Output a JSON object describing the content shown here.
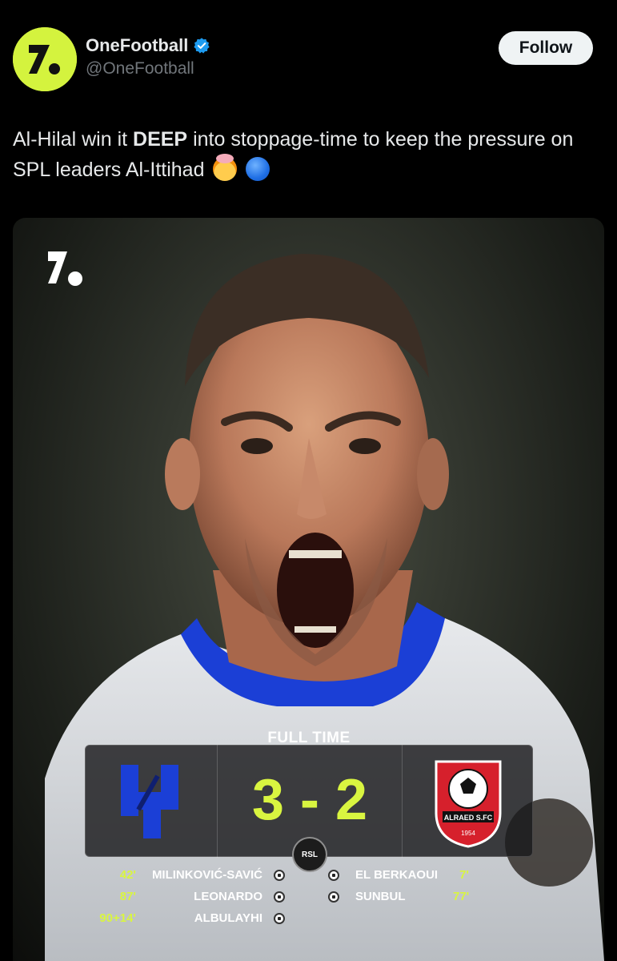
{
  "post": {
    "display_name": "OneFootball",
    "handle": "@OneFootball",
    "follow_label": "Follow",
    "text_before": "Al-Hilal win it ",
    "text_bold": "DEEP",
    "text_after": " into stoppage-time to keep the pressure on SPL leaders Al-Ittihad",
    "emoji_1": "exploding-head-emoji",
    "emoji_2": "blue-circle-emoji"
  },
  "graphic": {
    "status_label": "FULL TIME",
    "home_score": "3",
    "separator": "-",
    "away_score": "2",
    "home_team_icon": "al-hilal-crest",
    "away_team_icon": "al-raed-crest",
    "league_logo_text": "RSL",
    "away_crest_text": "ALRAED S.FC",
    "away_crest_year": "1954",
    "home_scorers": [
      {
        "minute": "42'",
        "player": "MILINKOVIĆ-SAVIĆ"
      },
      {
        "minute": "87'",
        "player": "LEONARDO"
      },
      {
        "minute": "90+14'",
        "player": "ALBULAYHI"
      }
    ],
    "away_scorers": [
      {
        "minute": "7'",
        "player": "EL BERKAOUI"
      },
      {
        "minute": "77'",
        "player": "SUNBUL"
      }
    ]
  },
  "colors": {
    "accent_lime": "#d9f540",
    "avatar_bg": "#d4f33e",
    "verified_blue": "#1d9bf0",
    "home_blue": "#1b3fd6",
    "away_red": "#d6202c"
  }
}
